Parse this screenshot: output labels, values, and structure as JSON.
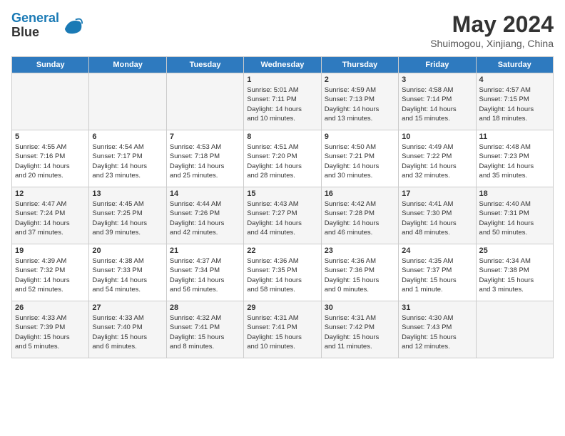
{
  "header": {
    "logo_line1": "General",
    "logo_line2": "Blue",
    "month_title": "May 2024",
    "location": "Shuimogou, Xinjiang, China"
  },
  "days_of_week": [
    "Sunday",
    "Monday",
    "Tuesday",
    "Wednesday",
    "Thursday",
    "Friday",
    "Saturday"
  ],
  "weeks": [
    [
      {
        "day": "",
        "info": ""
      },
      {
        "day": "",
        "info": ""
      },
      {
        "day": "",
        "info": ""
      },
      {
        "day": "1",
        "info": "Sunrise: 5:01 AM\nSunset: 7:11 PM\nDaylight: 14 hours\nand 10 minutes."
      },
      {
        "day": "2",
        "info": "Sunrise: 4:59 AM\nSunset: 7:13 PM\nDaylight: 14 hours\nand 13 minutes."
      },
      {
        "day": "3",
        "info": "Sunrise: 4:58 AM\nSunset: 7:14 PM\nDaylight: 14 hours\nand 15 minutes."
      },
      {
        "day": "4",
        "info": "Sunrise: 4:57 AM\nSunset: 7:15 PM\nDaylight: 14 hours\nand 18 minutes."
      }
    ],
    [
      {
        "day": "5",
        "info": "Sunrise: 4:55 AM\nSunset: 7:16 PM\nDaylight: 14 hours\nand 20 minutes."
      },
      {
        "day": "6",
        "info": "Sunrise: 4:54 AM\nSunset: 7:17 PM\nDaylight: 14 hours\nand 23 minutes."
      },
      {
        "day": "7",
        "info": "Sunrise: 4:53 AM\nSunset: 7:18 PM\nDaylight: 14 hours\nand 25 minutes."
      },
      {
        "day": "8",
        "info": "Sunrise: 4:51 AM\nSunset: 7:20 PM\nDaylight: 14 hours\nand 28 minutes."
      },
      {
        "day": "9",
        "info": "Sunrise: 4:50 AM\nSunset: 7:21 PM\nDaylight: 14 hours\nand 30 minutes."
      },
      {
        "day": "10",
        "info": "Sunrise: 4:49 AM\nSunset: 7:22 PM\nDaylight: 14 hours\nand 32 minutes."
      },
      {
        "day": "11",
        "info": "Sunrise: 4:48 AM\nSunset: 7:23 PM\nDaylight: 14 hours\nand 35 minutes."
      }
    ],
    [
      {
        "day": "12",
        "info": "Sunrise: 4:47 AM\nSunset: 7:24 PM\nDaylight: 14 hours\nand 37 minutes."
      },
      {
        "day": "13",
        "info": "Sunrise: 4:45 AM\nSunset: 7:25 PM\nDaylight: 14 hours\nand 39 minutes."
      },
      {
        "day": "14",
        "info": "Sunrise: 4:44 AM\nSunset: 7:26 PM\nDaylight: 14 hours\nand 42 minutes."
      },
      {
        "day": "15",
        "info": "Sunrise: 4:43 AM\nSunset: 7:27 PM\nDaylight: 14 hours\nand 44 minutes."
      },
      {
        "day": "16",
        "info": "Sunrise: 4:42 AM\nSunset: 7:28 PM\nDaylight: 14 hours\nand 46 minutes."
      },
      {
        "day": "17",
        "info": "Sunrise: 4:41 AM\nSunset: 7:30 PM\nDaylight: 14 hours\nand 48 minutes."
      },
      {
        "day": "18",
        "info": "Sunrise: 4:40 AM\nSunset: 7:31 PM\nDaylight: 14 hours\nand 50 minutes."
      }
    ],
    [
      {
        "day": "19",
        "info": "Sunrise: 4:39 AM\nSunset: 7:32 PM\nDaylight: 14 hours\nand 52 minutes."
      },
      {
        "day": "20",
        "info": "Sunrise: 4:38 AM\nSunset: 7:33 PM\nDaylight: 14 hours\nand 54 minutes."
      },
      {
        "day": "21",
        "info": "Sunrise: 4:37 AM\nSunset: 7:34 PM\nDaylight: 14 hours\nand 56 minutes."
      },
      {
        "day": "22",
        "info": "Sunrise: 4:36 AM\nSunset: 7:35 PM\nDaylight: 14 hours\nand 58 minutes."
      },
      {
        "day": "23",
        "info": "Sunrise: 4:36 AM\nSunset: 7:36 PM\nDaylight: 15 hours\nand 0 minutes."
      },
      {
        "day": "24",
        "info": "Sunrise: 4:35 AM\nSunset: 7:37 PM\nDaylight: 15 hours\nand 1 minute."
      },
      {
        "day": "25",
        "info": "Sunrise: 4:34 AM\nSunset: 7:38 PM\nDaylight: 15 hours\nand 3 minutes."
      }
    ],
    [
      {
        "day": "26",
        "info": "Sunrise: 4:33 AM\nSunset: 7:39 PM\nDaylight: 15 hours\nand 5 minutes."
      },
      {
        "day": "27",
        "info": "Sunrise: 4:33 AM\nSunset: 7:40 PM\nDaylight: 15 hours\nand 6 minutes."
      },
      {
        "day": "28",
        "info": "Sunrise: 4:32 AM\nSunset: 7:41 PM\nDaylight: 15 hours\nand 8 minutes."
      },
      {
        "day": "29",
        "info": "Sunrise: 4:31 AM\nSunset: 7:41 PM\nDaylight: 15 hours\nand 10 minutes."
      },
      {
        "day": "30",
        "info": "Sunrise: 4:31 AM\nSunset: 7:42 PM\nDaylight: 15 hours\nand 11 minutes."
      },
      {
        "day": "31",
        "info": "Sunrise: 4:30 AM\nSunset: 7:43 PM\nDaylight: 15 hours\nand 12 minutes."
      },
      {
        "day": "",
        "info": ""
      }
    ]
  ]
}
